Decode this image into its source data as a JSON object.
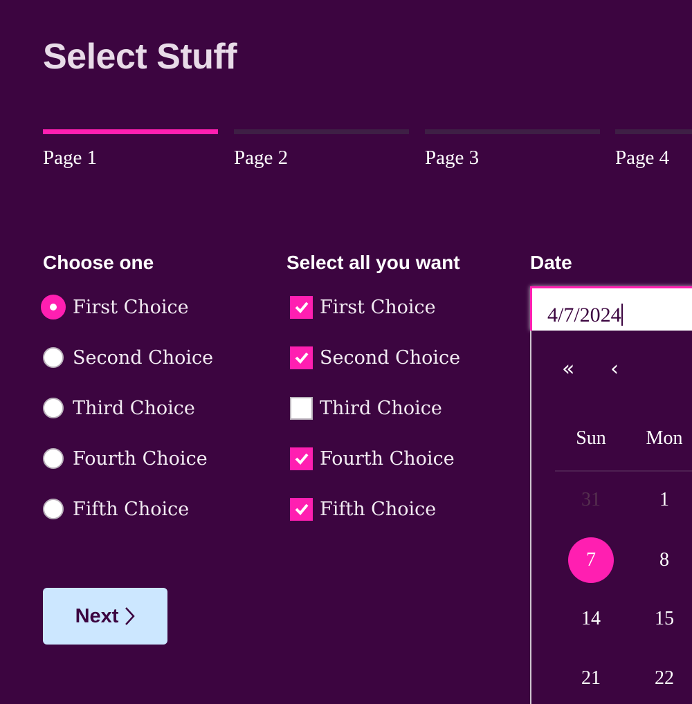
{
  "page": {
    "title": "Select Stuff"
  },
  "steps": [
    {
      "label": "Page 1",
      "active": true
    },
    {
      "label": "Page 2",
      "active": false
    },
    {
      "label": "Page 3",
      "active": false
    },
    {
      "label": "Page 4",
      "active": false
    }
  ],
  "radio_group": {
    "heading": "Choose one",
    "options": [
      {
        "label": "First Choice",
        "checked": true
      },
      {
        "label": "Second Choice",
        "checked": false
      },
      {
        "label": "Third Choice",
        "checked": false
      },
      {
        "label": "Fourth Choice",
        "checked": false
      },
      {
        "label": "Fifth Choice",
        "checked": false
      }
    ]
  },
  "checkbox_group": {
    "heading": "Select all you want",
    "options": [
      {
        "label": "First Choice",
        "checked": true
      },
      {
        "label": "Second Choice",
        "checked": true
      },
      {
        "label": "Third Choice",
        "checked": false
      },
      {
        "label": "Fourth Choice",
        "checked": true
      },
      {
        "label": "Fifth Choice",
        "checked": true
      }
    ]
  },
  "date": {
    "heading": "Date",
    "value": "4/7/2024",
    "calendar": {
      "nav_prev_year": "«",
      "nav_prev_month": "‹",
      "weekdays": [
        "Sun",
        "Mon"
      ],
      "rows": [
        [
          {
            "day": "31",
            "muted": true
          },
          {
            "day": "1",
            "muted": false
          }
        ],
        [
          {
            "day": "7",
            "selected": true
          },
          {
            "day": "8"
          }
        ],
        [
          {
            "day": "14"
          },
          {
            "day": "15"
          }
        ],
        [
          {
            "day": "21"
          },
          {
            "day": "22"
          }
        ]
      ]
    }
  },
  "actions": {
    "next_label": "Next",
    "next_icon": "chevron-right-icon"
  },
  "colors": {
    "background": "#3c0540",
    "accent": "#ff1fb1",
    "button": "#cce7ff"
  }
}
